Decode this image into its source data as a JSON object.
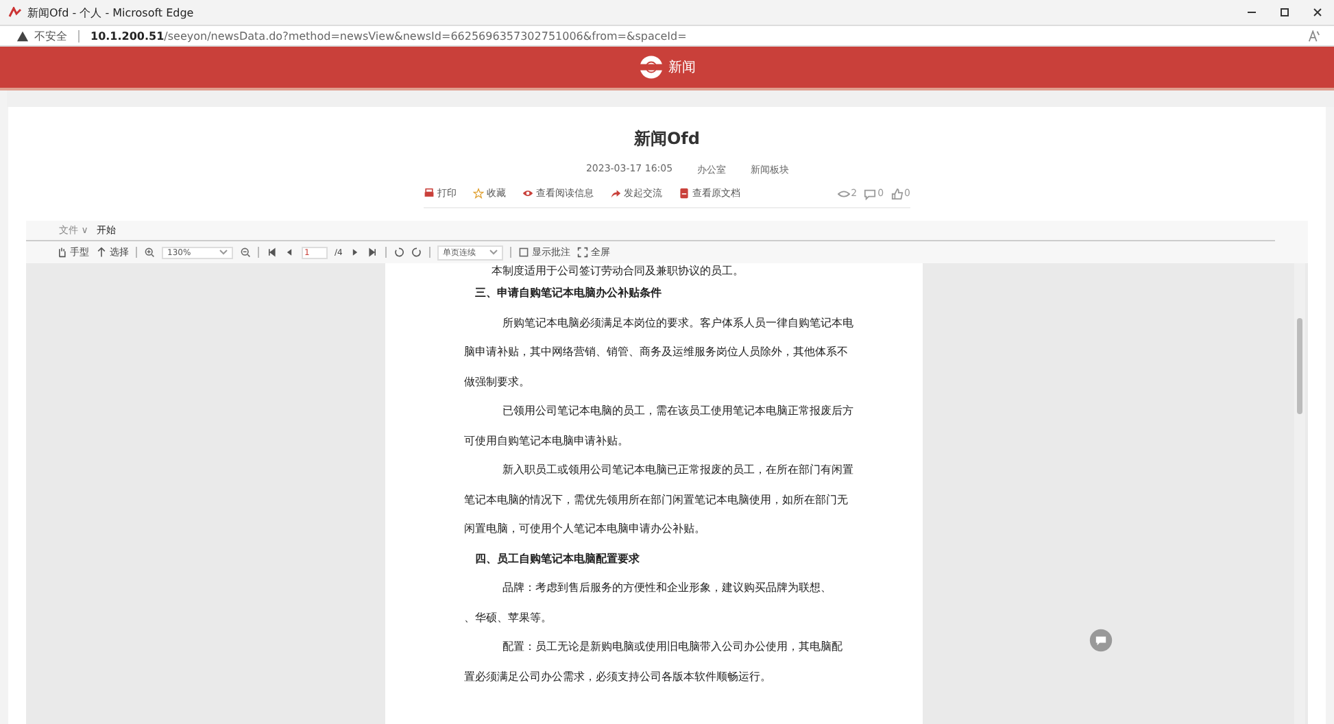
{
  "window": {
    "title": "新闻Ofd - 个人 - Microsoft Edge"
  },
  "address_bar": {
    "security": "不安全",
    "host": "10.1.200.51",
    "path": "/seeyon/newsData.do?method=newsView&newsId=6625696357302751006&from=&spaceId="
  },
  "header": {
    "title": "新闻"
  },
  "article": {
    "title": "新闻Ofd",
    "date": "2023-03-17 16:05",
    "department": "办公室",
    "board": "新闻板块",
    "actions": [
      {
        "kind": "print",
        "label": "打印"
      },
      {
        "kind": "star",
        "label": "收藏"
      },
      {
        "kind": "eye",
        "label": "查看阅读信息"
      },
      {
        "kind": "share",
        "label": "发起交流"
      },
      {
        "kind": "doc",
        "label": "查看原文档"
      }
    ],
    "stats": [
      {
        "kind": "views",
        "value": "2"
      },
      {
        "kind": "comments",
        "value": "0"
      },
      {
        "kind": "likes",
        "value": "0"
      }
    ]
  },
  "viewer": {
    "menu": [
      {
        "label": "文件 ∨",
        "selected": false
      },
      {
        "label": "开始",
        "selected": true
      }
    ],
    "tools": {
      "hand": "手型",
      "select": "选择",
      "zoom": "130%",
      "page": "1",
      "page_total": "/4",
      "layout": "单页连续",
      "annotations": {
        "label": "显示批注",
        "checked": false
      },
      "fullscreen": "全屏"
    },
    "document": [
      {
        "kind": "para",
        "lines": [
          "本制度适用于公司签订劳动合同及兼职协议的员工。"
        ]
      },
      {
        "kind": "heading",
        "lines": [
          "三、申请自购笔记本电脑办公补贴条件"
        ]
      },
      {
        "kind": "para",
        "lines": [
          "所购笔记本电脑必须满足本岗位的要求。客户体系人员一律自购笔记本电",
          "脑申请补贴，其中网络营销、销管、商务及运维服务岗位人员除外，其他体系不",
          "做强制要求。"
        ]
      },
      {
        "kind": "para",
        "lines": [
          "已领用公司笔记本电脑的员工，需在该员工使用笔记本电脑正常报废后方",
          "可使用自购笔记本电脑申请补贴。"
        ]
      },
      {
        "kind": "para",
        "lines": [
          "新入职员工或领用公司笔记本电脑已正常报废的员工，在所在部门有闲置",
          "笔记本电脑的情况下，需优先领用所在部门闲置笔记本电脑使用，如所在部门无",
          "闲置电脑，可使用个人笔记本电脑申请办公补贴。"
        ]
      },
      {
        "kind": "heading",
        "lines": [
          "四、员工自购笔记本电脑配置要求"
        ]
      },
      {
        "kind": "para",
        "lines": [
          "品牌：考虑到售后服务的方便性和企业形象，建议购买品牌为联想、",
          "、华硕、苹果等。"
        ]
      },
      {
        "kind": "para",
        "lines": [
          "配置：员工无论是新购电脑或使用旧电脑带入公司办公使用，其电脑配",
          "置必须满足公司办公需求，必须支持公司各版本软件顺畅运行。"
        ]
      }
    ]
  }
}
